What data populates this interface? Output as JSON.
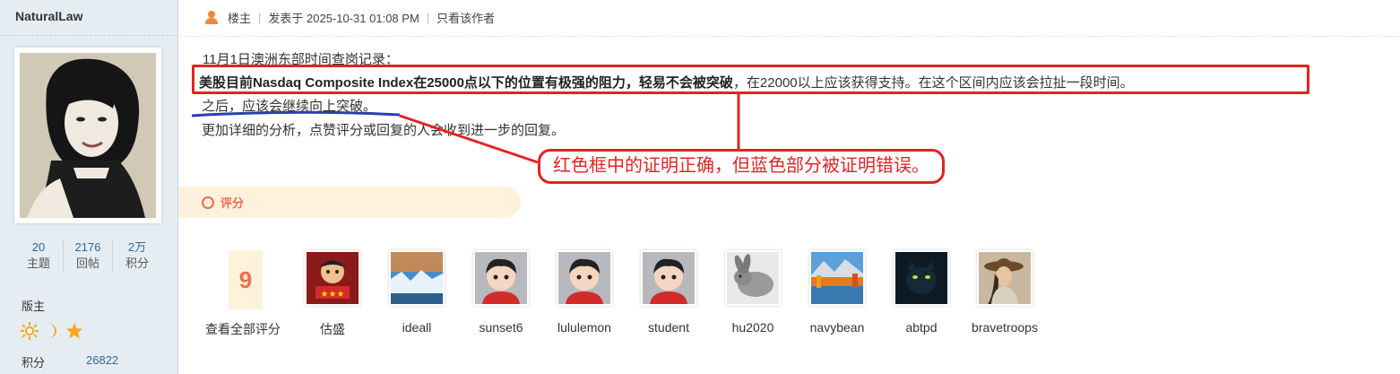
{
  "author": {
    "name": "NaturalLaw",
    "stats": [
      {
        "value": "20",
        "label": "主题"
      },
      {
        "value": "2176",
        "label": "回帖"
      },
      {
        "value": "2万",
        "label": "积分"
      }
    ],
    "role": "版主",
    "badge_icons": [
      "sun-icon",
      "moon-icon",
      "star-icon"
    ],
    "credit_label": "积分",
    "credit_value": "26822"
  },
  "post": {
    "floor_label": "楼主",
    "posted_at": "发表于 2025-10-31 01:08 PM",
    "only_author": "只看该作者",
    "lines": {
      "l1": "11月1日澳洲东部时间查岗记录：",
      "l2_bold": "美股目前Nasdaq Composite Index在25000点以下的位置有极强的阻力，轻易不会被突破",
      "l2_rest": "，在22000以上应该获得支持。在这个区间内应该会拉扯一段时间。",
      "l3": "之后，应该会继续向上突破。",
      "l4": "更加详细的分析，点赞评分或回复的人会收到进一步的回复。"
    }
  },
  "annotation": {
    "callout": "红色框中的证明正确，但蓝色部分被证明错误。",
    "box_color": "#e02424",
    "underline_color": "#2a3fb0"
  },
  "rating": {
    "label": "评分",
    "count": "9",
    "view_all": "查看全部评分",
    "raters": [
      {
        "name": "估盛",
        "avatar": "cartoon-red-avatar"
      },
      {
        "name": "ideall",
        "avatar": "glacier-avatar"
      },
      {
        "name": "sunset6",
        "avatar": "default-boy-avatar"
      },
      {
        "name": "lululemon",
        "avatar": "default-boy-avatar"
      },
      {
        "name": "student",
        "avatar": "default-boy-avatar"
      },
      {
        "name": "hu2020",
        "avatar": "rabbit-sketch-avatar"
      },
      {
        "name": "navybean",
        "avatar": "autumn-lake-avatar"
      },
      {
        "name": "abtpd",
        "avatar": "panther-avatar"
      },
      {
        "name": "bravetroops",
        "avatar": "woman-hat-avatar"
      }
    ]
  },
  "colors": {
    "sidebar_bg": "#e5edf2",
    "accent_orange": "#f26c4f",
    "rate_bg": "#fff1dc",
    "link_blue": "#336699"
  }
}
